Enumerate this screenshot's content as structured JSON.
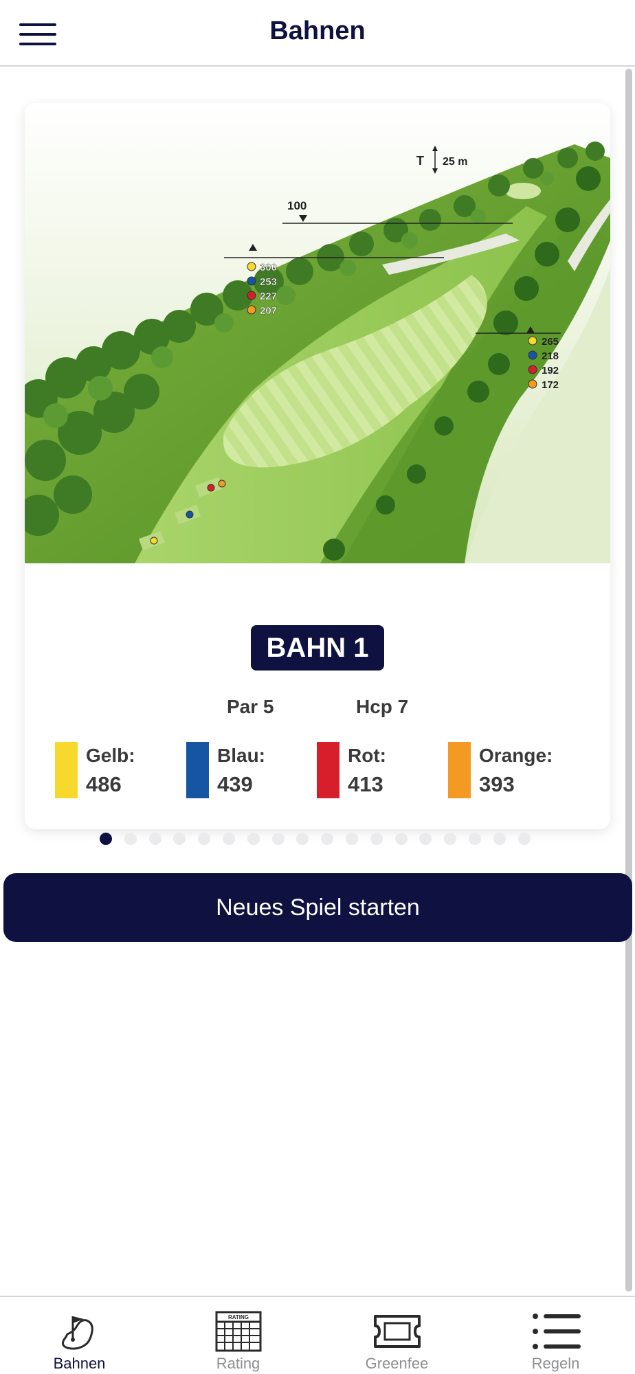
{
  "header": {
    "title": "Bahnen",
    "menu_icon": "hamburger-menu-icon"
  },
  "hole": {
    "badge": "BAHN 1",
    "par": "Par 5",
    "hcp": "Hcp 7",
    "map_labels": {
      "elevation": "T",
      "elevation_value": "25 m",
      "marker_100": "100",
      "left_distances": [
        "300",
        "253",
        "227",
        "207"
      ],
      "right_distances": [
        "265",
        "218",
        "192",
        "172"
      ]
    },
    "tees": [
      {
        "name": "Gelb:",
        "length": "486",
        "color": "#f7d92e"
      },
      {
        "name": "Blau:",
        "length": "439",
        "color": "#1655a2"
      },
      {
        "name": "Rot:",
        "length": "413",
        "color": "#d61f2a"
      },
      {
        "name": "Orange:",
        "length": "393",
        "color": "#f39a22"
      }
    ]
  },
  "pager": {
    "total": 18,
    "current": 1
  },
  "start_button": {
    "label": "Neues Spiel starten"
  },
  "tabbar": {
    "items": [
      {
        "label": "Bahnen",
        "icon": "golf-course-icon",
        "active": true
      },
      {
        "label": "Rating",
        "icon": "rating-scorecard-icon",
        "active": false
      },
      {
        "label": "Greenfee",
        "icon": "greenfee-ticket-icon",
        "active": false
      },
      {
        "label": "Regeln",
        "icon": "rules-list-icon",
        "active": false
      }
    ],
    "rating_icon_text": "RATING"
  },
  "colors": {
    "primary": "#0f1240",
    "inactive": "#8e8e93"
  }
}
